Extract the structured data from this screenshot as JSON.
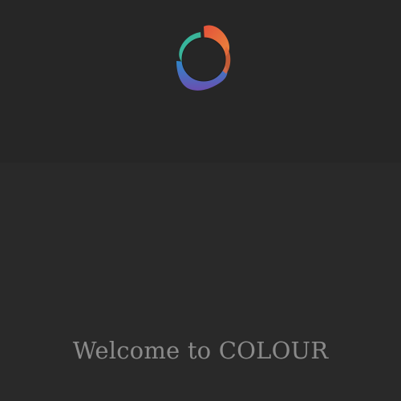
{
  "splash": {
    "logo_icon": "colour-swirl-logo-icon",
    "welcome_text": "Welcome to COLOUR"
  },
  "colors": {
    "background": "#282828",
    "text": "#8a8a8a",
    "logo_red": "#e4503a",
    "logo_orange": "#e98a3c",
    "logo_green": "#3bb39a",
    "logo_blue": "#2f86c9",
    "logo_purple": "#6a4fb0"
  }
}
